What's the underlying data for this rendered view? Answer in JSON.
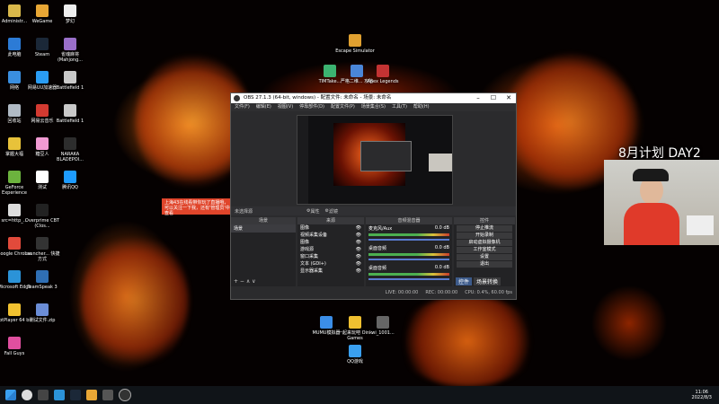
{
  "desktop_icons_left": [
    {
      "label": "Administr...",
      "color": "#d9b84a"
    },
    {
      "label": "此电脑",
      "color": "#2c7bd6"
    },
    {
      "label": "网络",
      "color": "#3a8fe0"
    },
    {
      "label": "回收站",
      "color": "#b0bac4"
    },
    {
      "label": "掌握大福",
      "color": "#e8c23a"
    },
    {
      "label": "GeForce Experience",
      "color": "#6cb33e"
    },
    {
      "label": "src=http_...",
      "color": "#dddddd"
    },
    {
      "label": "Google Chrome",
      "color": "#e24a3b"
    },
    {
      "label": "Microsoft Edge",
      "color": "#2b93d8"
    },
    {
      "label": "PotPlayer 64 bit",
      "color": "#f2c230"
    },
    {
      "label": "Fall Guys",
      "color": "#e04f9f"
    }
  ],
  "desktop_icons_col2": [
    {
      "label": "WeGame",
      "color": "#e8a735"
    },
    {
      "label": "Steam",
      "color": "#1b2838"
    },
    {
      "label": "网易UU加速器",
      "color": "#2a9df4"
    },
    {
      "label": "网易云音乐",
      "color": "#d33a31"
    },
    {
      "label": "糖豆人",
      "color": "#f19bd3"
    },
    {
      "label": "测试",
      "color": "#ffffff"
    },
    {
      "label": "Overprime CBT (Clos...",
      "color": "#222222"
    },
    {
      "label": "Launcher... 快捷方式",
      "color": "#333333"
    },
    {
      "label": "TeamSpeak 3",
      "color": "#2f6fb4"
    },
    {
      "label": "测试文件.zip",
      "color": "#6b8dd6"
    }
  ],
  "desktop_icons_col3": [
    {
      "label": "梦幻",
      "color": "#eeeeee"
    },
    {
      "label": "雀魂麻将 (Mahjong...",
      "color": "#9a6fc9"
    },
    {
      "label": "Battlefield 1",
      "color": "#c9c9c9"
    },
    {
      "label": "Battlefield 1",
      "color": "#c9c9c9"
    },
    {
      "label": "NARAKA BLADEPOI...",
      "color": "#2d2d2d"
    },
    {
      "label": "腾讯QQ",
      "color": "#1e9cff"
    }
  ],
  "desktop_icons_center": [
    {
      "label": "Escape Simulator",
      "color": "#e0a030"
    },
    {
      "label": "TIMTake...",
      "color": "#3cb371"
    },
    {
      "label": "严格二维... 攻略",
      "color": "#4a86d8"
    },
    {
      "label": "Apex Legends",
      "color": "#c33333"
    }
  ],
  "desktop_icons_bottom": [
    {
      "label": "MUMU模拟器",
      "color": "#3b8ee8"
    },
    {
      "label": "一起来玩吧 Oink Games",
      "color": "#f0c030"
    },
    {
      "label": "wi_1001...",
      "color": "#666666"
    },
    {
      "label": "QQ游戏",
      "color": "#3aa0f0"
    }
  ],
  "obs": {
    "title": "OBS 27.1.3 (64-bit, windows) - 配置文件: 未命名 - 场景: 未命名",
    "menu": [
      "文件(F)",
      "编辑(E)",
      "视图(V)",
      "停靠部件(D)",
      "配置文件(P)",
      "场景集合(S)",
      "工具(T)",
      "帮助(H)"
    ],
    "current_scene_label": "未选择源",
    "props_button": "属性",
    "filters_button": "滤镜",
    "dock_titles": [
      "场景",
      "来源",
      "音频混音器",
      "转场动画",
      "控件"
    ],
    "scenes": [
      "场景"
    ],
    "sources": [
      "图像",
      "视频采集设备",
      "图像",
      "游戏源",
      "窗口采集",
      "文本 (GDI+)",
      "显示器采集"
    ],
    "mixer": [
      {
        "name": "麦克风/Aux",
        "level": "0.0 dB"
      },
      {
        "name": "桌面音频",
        "level": "0.0 dB"
      },
      {
        "name": "桌面音频",
        "level": "0.0 dB"
      }
    ],
    "transition": {
      "name": "淡出",
      "duration_label": "时长",
      "duration": "300 ms"
    },
    "controls": [
      "停止推流",
      "开始录制",
      "启动虚拟摄像机",
      "工作室模式",
      "设置",
      "退出"
    ],
    "bottom_tabs": [
      "控件",
      "场景转换"
    ],
    "status": {
      "live": "LIVE: 00:00:00",
      "rec": "REC: 00:00:00",
      "cpu": "CPU: 0.4%, 60.00 fps"
    }
  },
  "overlay": {
    "title": "8月计划 DAY2"
  },
  "notice": {
    "text": "上海43在线看带你玩了直播哦，可以关注一下我，还有'管理员'中查看"
  },
  "clock": {
    "time": "11:06",
    "date": "2022/8/3"
  }
}
